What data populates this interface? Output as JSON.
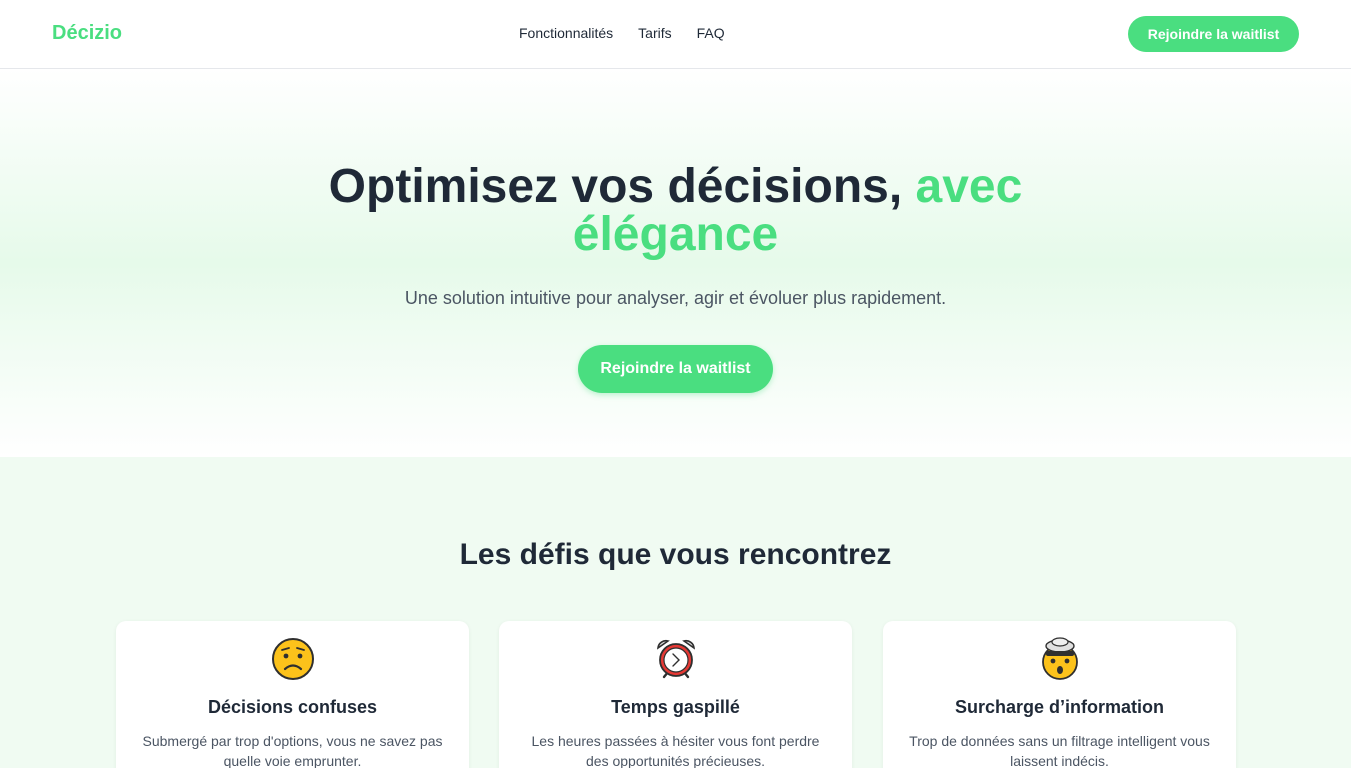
{
  "nav": {
    "logo": "Décizio",
    "links": [
      "Fonctionnalités",
      "Tarifs",
      "FAQ"
    ],
    "cta": "Rejoindre la waitlist"
  },
  "hero": {
    "title_main": "Optimisez vos décisions,",
    "title_accent": "avec élégance",
    "subtitle": "Une solution intuitive pour analyser, agir et évoluer plus rapidement.",
    "cta": "Rejoindre la waitlist"
  },
  "challenges": {
    "title": "Les défis que vous rencontrez",
    "cards": [
      {
        "icon": "worried-face-icon",
        "title": "Décisions confuses",
        "text": "Submergé par trop d'options, vous ne savez pas quelle voie emprunter."
      },
      {
        "icon": "alarm-clock-icon",
        "title": "Temps gaspillé",
        "text": "Les heures passées à hésiter vous font perdre des opportunités précieuses."
      },
      {
        "icon": "exploding-head-icon",
        "title": "Surcharge d’information",
        "text": "Trop de données sans un filtrage intelligent vous laissent indécis."
      }
    ]
  },
  "colors": {
    "accent": "#4ade80",
    "text": "#1f2937",
    "muted": "#4b5563",
    "section_bg": "#f0fbf2"
  }
}
